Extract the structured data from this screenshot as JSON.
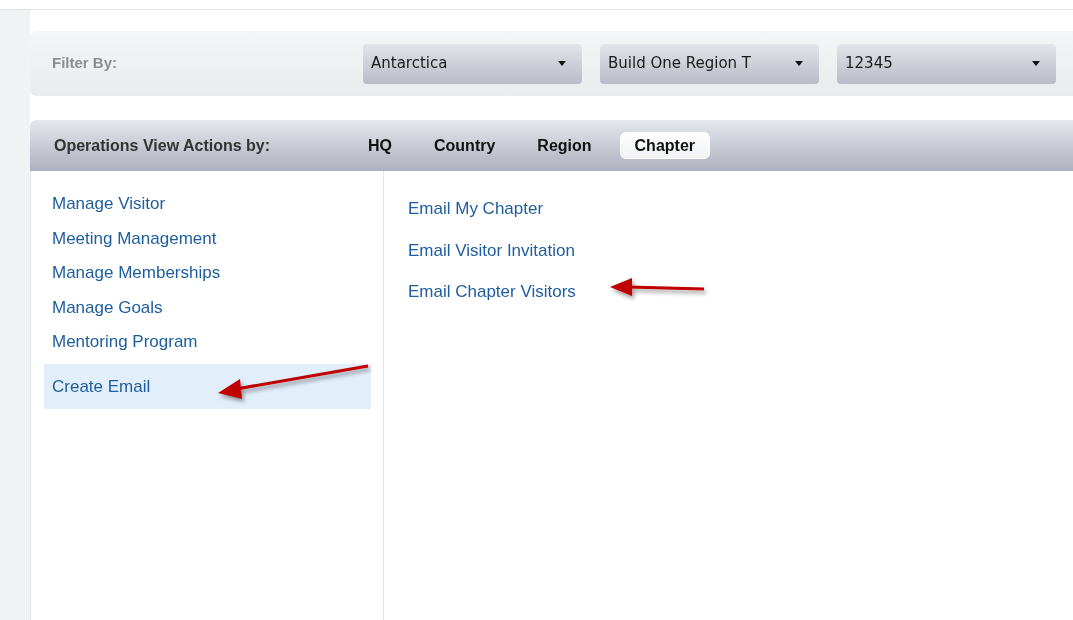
{
  "filter_bar": {
    "label": "Filter By:",
    "dropdowns": [
      {
        "value": "Antarctica"
      },
      {
        "value": "Build One Region T"
      },
      {
        "value": "12345"
      }
    ]
  },
  "action_bar": {
    "label": "Operations View Actions by:",
    "tabs": [
      {
        "label": "HQ",
        "selected": false
      },
      {
        "label": "Country",
        "selected": false
      },
      {
        "label": "Region",
        "selected": false
      },
      {
        "label": "Chapter",
        "selected": true
      }
    ]
  },
  "sidebar": {
    "items": [
      {
        "label": "Manage Visitor",
        "selected": false
      },
      {
        "label": "Meeting Management",
        "selected": false
      },
      {
        "label": "Manage Memberships",
        "selected": false
      },
      {
        "label": "Manage Goals",
        "selected": false
      },
      {
        "label": "Mentoring Program",
        "selected": false
      },
      {
        "label": "Create Email",
        "selected": true
      }
    ]
  },
  "actions": [
    {
      "label": "Email My Chapter"
    },
    {
      "label": "Email Visitor Invitation"
    },
    {
      "label": "Email Chapter Visitors"
    }
  ]
}
